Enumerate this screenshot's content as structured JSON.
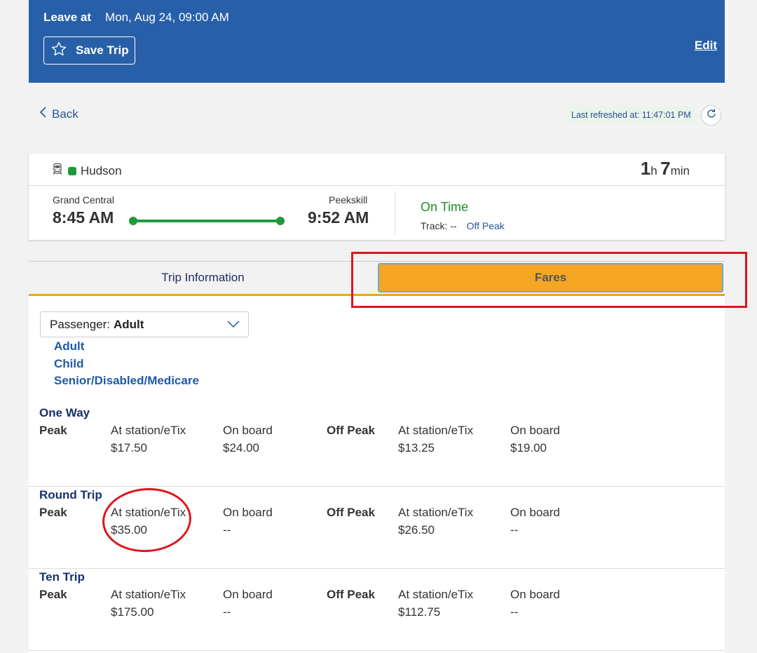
{
  "header": {
    "leave_label": "Leave at",
    "leave_value": "Mon, Aug 24, 09:00 AM",
    "save_trip_label": "Save Trip",
    "edit_label": "Edit"
  },
  "nav": {
    "back_label": "Back",
    "last_refreshed": "Last refreshed at: 11:47:01 PM"
  },
  "trip": {
    "line_name": "Hudson",
    "line_color": "#1e9a3a",
    "duration": {
      "hours": "1",
      "hours_unit": "h",
      "minutes": "7",
      "minutes_unit": "min"
    },
    "origin": {
      "station": "Grand Central",
      "time": "8:45 AM"
    },
    "destination": {
      "station": "Peekskill",
      "time": "9:52 AM"
    },
    "status": "On Time",
    "track": "Track: --",
    "peak_type": "Off Peak"
  },
  "tabs": [
    {
      "label": "Trip Information",
      "active": false
    },
    {
      "label": "Fares",
      "active": true
    }
  ],
  "fares": {
    "passenger_label": "Passenger:",
    "passenger_value": "Adult",
    "passenger_options": [
      "Adult",
      "Child",
      "Senior/Disabled/Medicare"
    ],
    "sections": [
      {
        "title": "One Way",
        "peak_label": "Peak",
        "peak_station_label": "At station/eTix",
        "peak_station_price": "$17.50",
        "peak_onboard_label": "On board",
        "peak_onboard_price": "$24.00",
        "offpeak_label": "Off Peak",
        "offpeak_station_label": "At station/eTix",
        "offpeak_station_price": "$13.25",
        "offpeak_onboard_label": "On board",
        "offpeak_onboard_price": "$19.00"
      },
      {
        "title": "Round Trip",
        "peak_label": "Peak",
        "peak_station_label": "At station/eTix",
        "peak_station_price": "$35.00",
        "peak_onboard_label": "On board",
        "peak_onboard_price": "--",
        "offpeak_label": "Off Peak",
        "offpeak_station_label": "At station/eTix",
        "offpeak_station_price": "$26.50",
        "offpeak_onboard_label": "On board",
        "offpeak_onboard_price": "--"
      },
      {
        "title": "Ten Trip",
        "peak_label": "Peak",
        "peak_station_label": "At station/eTix",
        "peak_station_price": "$175.00",
        "peak_onboard_label": "On board",
        "peak_onboard_price": "--",
        "offpeak_label": "Off Peak",
        "offpeak_station_label": "At station/eTix",
        "offpeak_station_price": "$112.75",
        "offpeak_onboard_label": "On board",
        "offpeak_onboard_price": "--"
      }
    ]
  },
  "colors": {
    "header_bg": "#2760a9",
    "accent_orange": "#f5a623",
    "link_blue": "#1f5aa6",
    "status_green": "#1e8a2a",
    "annotation_red": "#e0161c"
  }
}
